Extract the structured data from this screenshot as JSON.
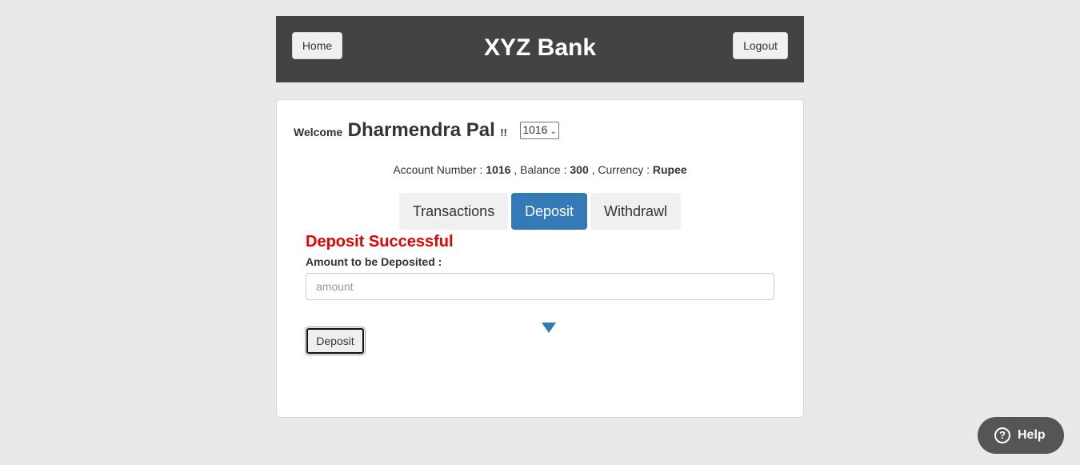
{
  "header": {
    "home_label": "Home",
    "title": "XYZ Bank",
    "logout_label": "Logout"
  },
  "welcome": {
    "prefix": "Welcome",
    "user_name": "Dharmendra Pal",
    "suffix": "!!",
    "account_select": {
      "selected": "1016"
    }
  },
  "account_info": {
    "account_number_label": "Account Number :",
    "account_number": "1016",
    "balance_label": ", Balance :",
    "balance": "300",
    "currency_label": ", Currency :",
    "currency": "Rupee"
  },
  "tabs": [
    {
      "label": "Transactions",
      "active": false
    },
    {
      "label": "Deposit",
      "active": true
    },
    {
      "label": "Withdrawl",
      "active": false
    }
  ],
  "deposit_form": {
    "success_message": "Deposit Successful",
    "amount_label": "Amount to be Deposited :",
    "amount_placeholder": "amount",
    "amount_value": "",
    "submit_label": "Deposit"
  },
  "help": {
    "icon": "question-circle-icon",
    "label": "Help"
  },
  "colors": {
    "header_bg": "#434343",
    "active_tab": "#337ab7",
    "success_text": "#e60000",
    "page_bg": "#e9e9e9"
  }
}
